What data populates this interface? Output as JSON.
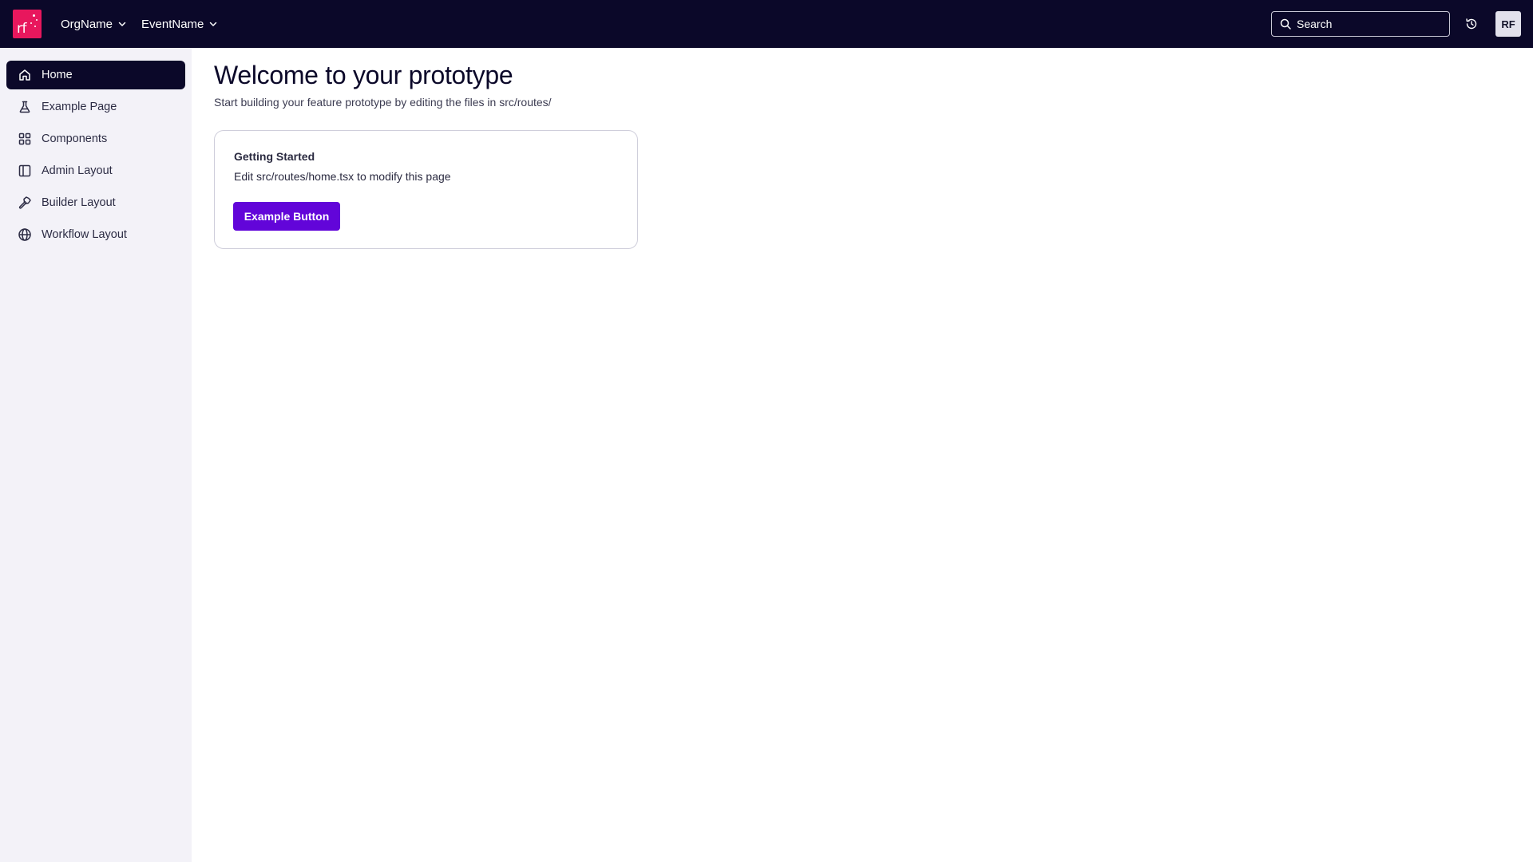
{
  "header": {
    "logo_text": "rf",
    "org_name": "OrgName",
    "event_name": "EventName",
    "search_placeholder": "Search",
    "avatar_initials": "RF"
  },
  "sidebar": {
    "items": [
      {
        "label": "Home",
        "icon": "home-icon",
        "active": true
      },
      {
        "label": "Example Page",
        "icon": "flask-icon",
        "active": false
      },
      {
        "label": "Components",
        "icon": "grid-icon",
        "active": false
      },
      {
        "label": "Admin Layout",
        "icon": "panel-left-icon",
        "active": false
      },
      {
        "label": "Builder Layout",
        "icon": "hammer-icon",
        "active": false
      },
      {
        "label": "Workflow Layout",
        "icon": "globe-icon",
        "active": false
      }
    ]
  },
  "main": {
    "title": "Welcome to your prototype",
    "subtitle": "Start building your feature prototype by editing the files in src/routes/",
    "card": {
      "title": "Getting Started",
      "text": "Edit src/routes/home.tsx to modify this page",
      "button_label": "Example Button"
    }
  },
  "colors": {
    "header_bg": "#0b0829",
    "logo_bg": "#e8175d",
    "accent_button": "#6205d9",
    "sidebar_bg": "#f3f2f8"
  }
}
